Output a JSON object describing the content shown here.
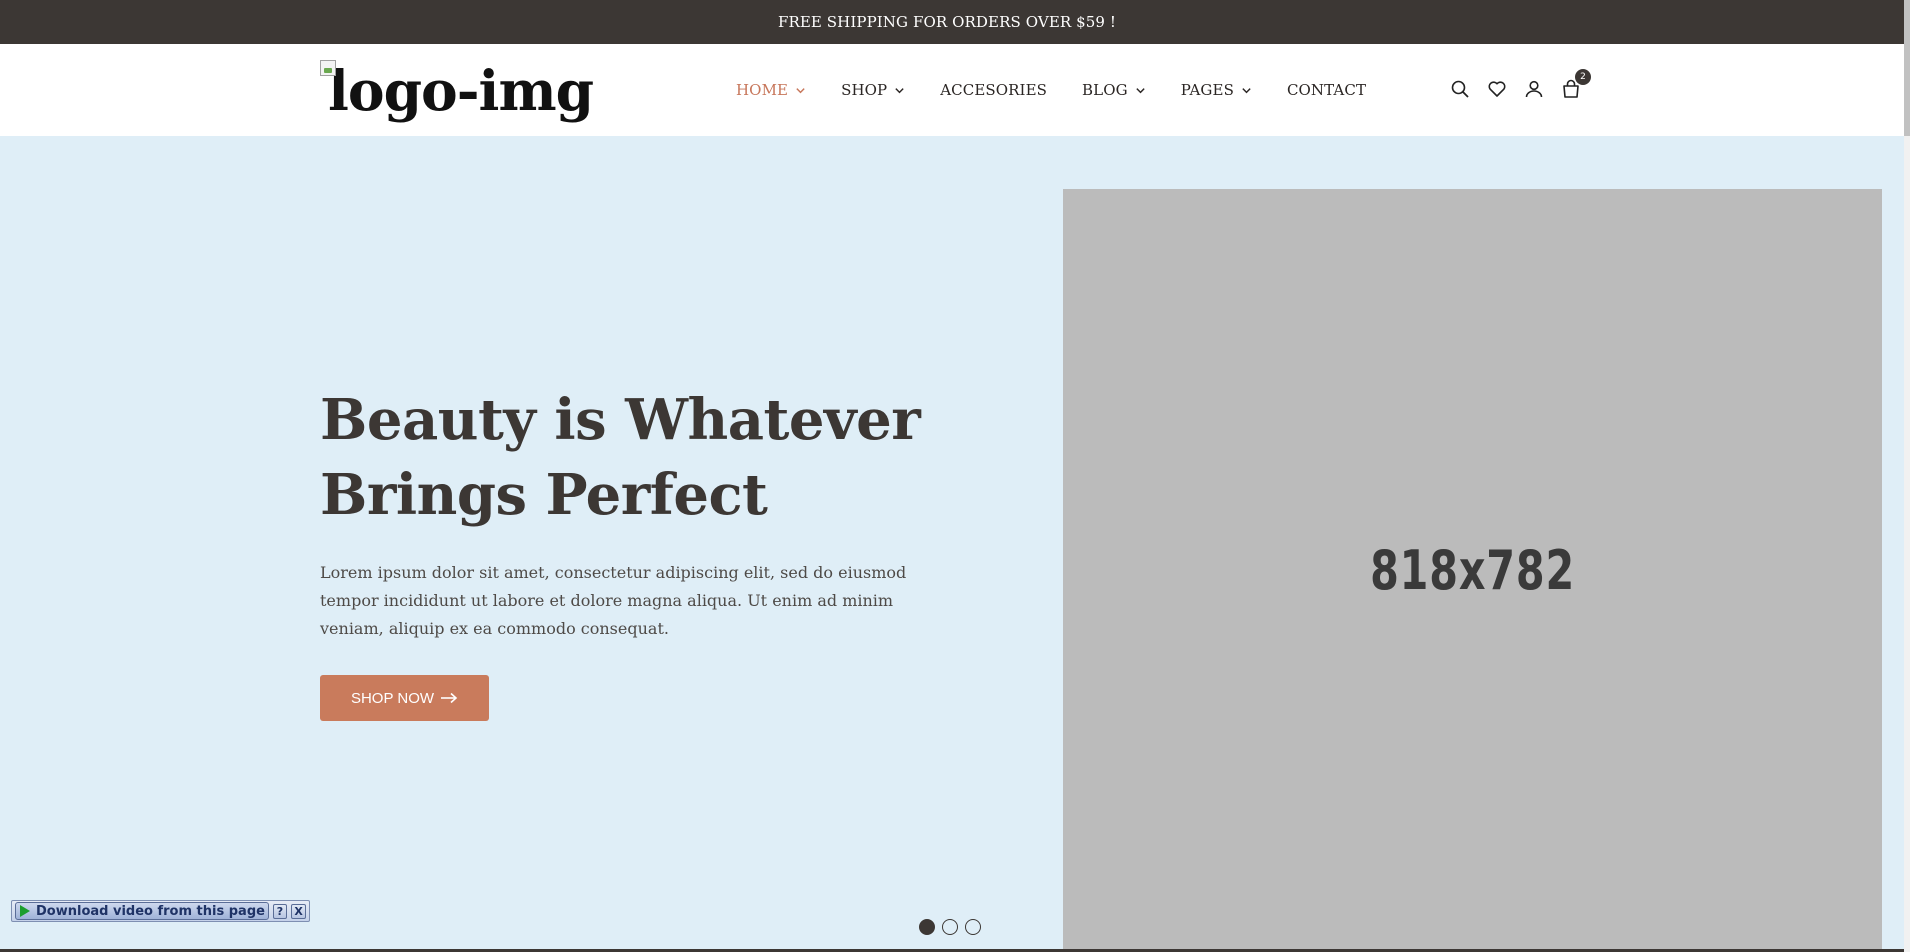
{
  "topbar": {
    "text": "FREE SHIPPING FOR ORDERS OVER $59 !"
  },
  "header": {
    "logo_alt": "logo-img",
    "nav": [
      {
        "label": "HOME",
        "active": true,
        "has_dropdown": true
      },
      {
        "label": "SHOP",
        "active": false,
        "has_dropdown": true
      },
      {
        "label": "ACCESORIES",
        "active": false,
        "has_dropdown": false
      },
      {
        "label": "BLOG",
        "active": false,
        "has_dropdown": true
      },
      {
        "label": "PAGES",
        "active": false,
        "has_dropdown": true
      },
      {
        "label": "CONTACT",
        "active": false,
        "has_dropdown": false
      }
    ],
    "icons": [
      "search-icon",
      "heart-icon",
      "user-icon",
      "cart-icon"
    ],
    "cart_count": "2"
  },
  "hero": {
    "title_line1": "Beauty is Whatever",
    "title_line2": "Brings Perfect",
    "description": "Lorem ipsum dolor sit amet, consectetur adipiscing elit, sed do eiusmod tempor incididunt ut labore et dolore magna aliqua. Ut enim ad minim veniam, aliquip ex ea commodo consequat.",
    "button_label": "SHOP NOW",
    "image_placeholder": "818x782",
    "slides_count": 3,
    "active_slide": 1
  },
  "download_widget": {
    "label": "Download video from this page",
    "help": "?",
    "close": "X"
  },
  "colors": {
    "topbar_bg": "#3c3734",
    "accent": "#c97b5c",
    "hero_bg": "#dfeef7",
    "placeholder_bg": "#bbbbbb"
  }
}
